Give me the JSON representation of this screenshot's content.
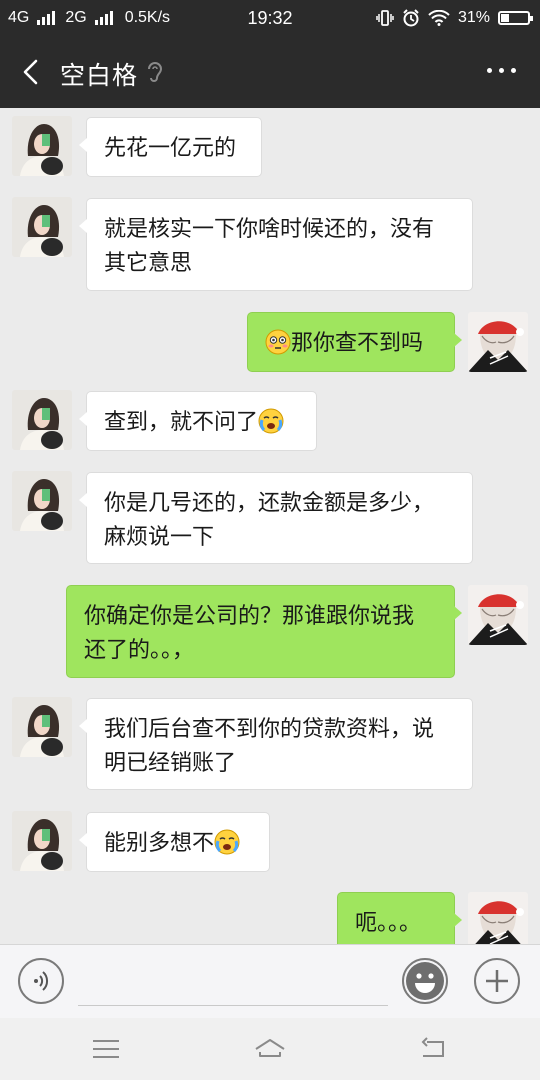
{
  "status_bar": {
    "network1": "4G",
    "network2": "2G",
    "speed": "0.5K/s",
    "time": "19:32",
    "battery": "31%",
    "battery_level": 0.31
  },
  "header": {
    "title": "空白格"
  },
  "messages": [
    {
      "side": "in",
      "text": "先花一亿元的",
      "lines": [
        "先花一亿元的"
      ]
    },
    {
      "side": "in",
      "text": "就是核实一下你啥时候还的，没有其它意思",
      "lines": [
        "就是核实一下你啥时候还的，没有",
        "其它意思"
      ]
    },
    {
      "side": "out",
      "emoji": "flushed-face",
      "text": "那你查不到吗",
      "lines": [
        "那你查不到吗"
      ]
    },
    {
      "side": "in",
      "text": "查到，就不问了",
      "emoji_after": "crying-face",
      "lines": [
        "查到，就不问了"
      ]
    },
    {
      "side": "in",
      "text": "你是几号还的，还款金额是多少，麻烦说一下",
      "lines": [
        "你是几号还的，还款金额是多少，",
        "麻烦说一下"
      ]
    },
    {
      "side": "out",
      "text": "你确定你是公司的？那谁跟你说我还了的。。，",
      "lines": [
        "你确定你是公司的？那谁跟你说我",
        "还了的。。，"
      ]
    },
    {
      "side": "in",
      "text": "我们后台查不到你的贷款资料，说明已经销账了",
      "lines": [
        "我们后台查不到你的贷款资料，说",
        "明已经销账了"
      ]
    },
    {
      "side": "in",
      "text": "能别多想不",
      "emoji_after": "crying-face",
      "lines": [
        "能别多想不"
      ]
    },
    {
      "side": "out",
      "text": "呃。。。",
      "lines": [
        "呃。。。"
      ]
    }
  ],
  "colors": {
    "bar": "#2b2b2b",
    "chat_bg": "#ebebeb",
    "out_bubble": "#9fe55e",
    "in_bubble": "#ffffff"
  }
}
